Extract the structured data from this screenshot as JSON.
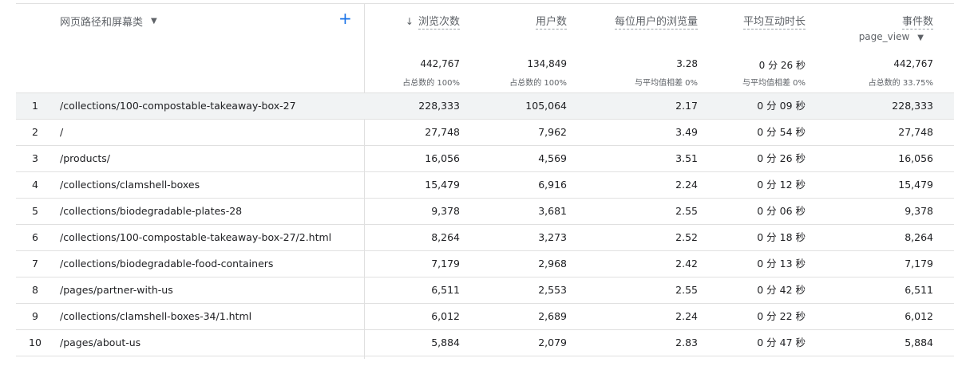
{
  "header": {
    "dimension_label": "网页路径和屏幕类",
    "add_label": "+",
    "metrics": [
      {
        "label": "浏览次数",
        "sorted": true,
        "total": "442,767",
        "sub": "占总数的 100%"
      },
      {
        "label": "用户数",
        "total": "134,849",
        "sub": "占总数的 100%"
      },
      {
        "label": "每位用户的浏览量",
        "total": "3.28",
        "sub": "与平均值相差 0%"
      },
      {
        "label": "平均互动时长",
        "total": "0 分 26 秒",
        "sub": "与平均值相差 0%"
      },
      {
        "label": "事件数",
        "event_filter": "page_view",
        "total": "442,767",
        "sub": "占总数的 33.75%"
      }
    ]
  },
  "rows": [
    {
      "index": "1",
      "path": "/collections/100-compostable-takeaway-box-27",
      "views": "228,333",
      "users": "105,064",
      "views_per_user": "2.17",
      "engagement": "0 分 09 秒",
      "events": "228,333"
    },
    {
      "index": "2",
      "path": "/",
      "views": "27,748",
      "users": "7,962",
      "views_per_user": "3.49",
      "engagement": "0 分 54 秒",
      "events": "27,748"
    },
    {
      "index": "3",
      "path": "/products/",
      "views": "16,056",
      "users": "4,569",
      "views_per_user": "3.51",
      "engagement": "0 分 26 秒",
      "events": "16,056"
    },
    {
      "index": "4",
      "path": "/collections/clamshell-boxes",
      "views": "15,479",
      "users": "6,916",
      "views_per_user": "2.24",
      "engagement": "0 分 12 秒",
      "events": "15,479"
    },
    {
      "index": "5",
      "path": "/collections/biodegradable-plates-28",
      "views": "9,378",
      "users": "3,681",
      "views_per_user": "2.55",
      "engagement": "0 分 06 秒",
      "events": "9,378"
    },
    {
      "index": "6",
      "path": "/collections/100-compostable-takeaway-box-27/2.html",
      "views": "8,264",
      "users": "3,273",
      "views_per_user": "2.52",
      "engagement": "0 分 18 秒",
      "events": "8,264"
    },
    {
      "index": "7",
      "path": "/collections/biodegradable-food-containers",
      "views": "7,179",
      "users": "2,968",
      "views_per_user": "2.42",
      "engagement": "0 分 13 秒",
      "events": "7,179"
    },
    {
      "index": "8",
      "path": "/pages/partner-with-us",
      "views": "6,511",
      "users": "2,553",
      "views_per_user": "2.55",
      "engagement": "0 分 42 秒",
      "events": "6,511"
    },
    {
      "index": "9",
      "path": "/collections/clamshell-boxes-34/1.html",
      "views": "6,012",
      "users": "2,689",
      "views_per_user": "2.24",
      "engagement": "0 分 22 秒",
      "events": "6,012"
    },
    {
      "index": "10",
      "path": "/pages/about-us",
      "views": "5,884",
      "users": "2,079",
      "views_per_user": "2.83",
      "engagement": "0 分 47 秒",
      "events": "5,884"
    }
  ]
}
